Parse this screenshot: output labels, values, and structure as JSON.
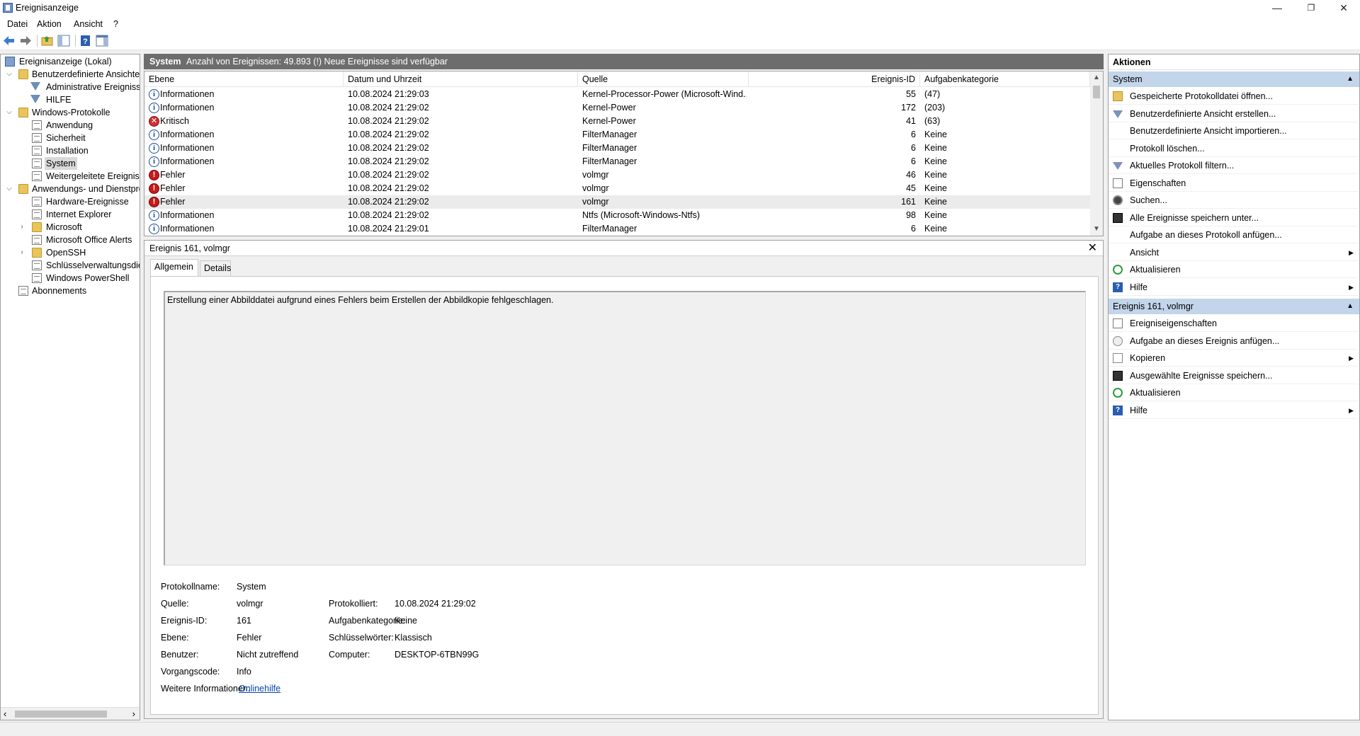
{
  "window": {
    "title": "Ereignisanzeige",
    "minimize": "—",
    "restore": "❐",
    "close": "✕"
  },
  "menu": [
    "Datei",
    "Aktion",
    "Ansicht",
    "?"
  ],
  "tree": {
    "root": "Ereignisanzeige (Lokal)",
    "custom_views": "Benutzerdefinierte Ansichten",
    "admin_events": "Administrative Ereignisse",
    "hilfe": "HILFE",
    "windows_logs": "Windows-Protokolle",
    "application": "Anwendung",
    "security": "Sicherheit",
    "installation": "Installation",
    "system": "System",
    "forwarded": "Weitergeleitete Ereignisse",
    "app_services": "Anwendungs- und Dienstprotokolle",
    "hardware": "Hardware-Ereignisse",
    "ie": "Internet Explorer",
    "microsoft": "Microsoft",
    "office_alerts": "Microsoft Office Alerts",
    "openssh": "OpenSSH",
    "key_mgmt": "Schlüsselverwaltungsdienst",
    "powershell": "Windows PowerShell",
    "subscriptions": "Abonnements"
  },
  "center_header": {
    "title": "System",
    "info": "Anzahl von Ereignissen: 49.893 (!) Neue Ereignisse sind verfügbar"
  },
  "grid": {
    "columns": [
      "Ebene",
      "Datum und Uhrzeit",
      "Quelle",
      "Ereignis-ID",
      "Aufgabenkategorie"
    ],
    "rows": [
      {
        "level": "Informationen",
        "kind": "info",
        "date": "10.08.2024 21:29:03",
        "source": "Kernel-Processor-Power (Microsoft-Wind...",
        "id": "55",
        "cat": "(47)"
      },
      {
        "level": "Informationen",
        "kind": "info",
        "date": "10.08.2024 21:29:02",
        "source": "Kernel-Power",
        "id": "172",
        "cat": "(203)"
      },
      {
        "level": "Kritisch",
        "kind": "crit",
        "date": "10.08.2024 21:29:02",
        "source": "Kernel-Power",
        "id": "41",
        "cat": "(63)"
      },
      {
        "level": "Informationen",
        "kind": "info",
        "date": "10.08.2024 21:29:02",
        "source": "FilterManager",
        "id": "6",
        "cat": "Keine"
      },
      {
        "level": "Informationen",
        "kind": "info",
        "date": "10.08.2024 21:29:02",
        "source": "FilterManager",
        "id": "6",
        "cat": "Keine"
      },
      {
        "level": "Informationen",
        "kind": "info",
        "date": "10.08.2024 21:29:02",
        "source": "FilterManager",
        "id": "6",
        "cat": "Keine"
      },
      {
        "level": "Fehler",
        "kind": "err",
        "date": "10.08.2024 21:29:02",
        "source": "volmgr",
        "id": "46",
        "cat": "Keine"
      },
      {
        "level": "Fehler",
        "kind": "err",
        "date": "10.08.2024 21:29:02",
        "source": "volmgr",
        "id": "45",
        "cat": "Keine"
      },
      {
        "level": "Fehler",
        "kind": "err",
        "date": "10.08.2024 21:29:02",
        "source": "volmgr",
        "id": "161",
        "cat": "Keine",
        "selected": true
      },
      {
        "level": "Informationen",
        "kind": "info",
        "date": "10.08.2024 21:29:02",
        "source": "Ntfs (Microsoft-Windows-Ntfs)",
        "id": "98",
        "cat": "Keine"
      },
      {
        "level": "Informationen",
        "kind": "info",
        "date": "10.08.2024 21:29:01",
        "source": "FilterManager",
        "id": "6",
        "cat": "Keine"
      }
    ]
  },
  "detail": {
    "header": "Ereignis 161, volmgr",
    "close": "✕",
    "tab_general": "Allgemein",
    "tab_details": "Details",
    "description": "Erstellung einer Abbilddatei aufgrund eines Fehlers beim Erstellen der Abbildkopie fehlgeschlagen.",
    "labels": {
      "log_name": "Protokollname:",
      "source": "Quelle:",
      "event_id": "Ereignis-ID:",
      "level": "Ebene:",
      "user": "Benutzer:",
      "opcode": "Vorgangscode:",
      "more_info": "Weitere Informationen:",
      "logged": "Protokolliert:",
      "task_category": "Aufgabenkategorie:",
      "keywords": "Schlüsselwörter:",
      "computer": "Computer:"
    },
    "values": {
      "log_name": "System",
      "source": "volmgr",
      "event_id": "161",
      "level": "Fehler",
      "user": "Nicht zutreffend",
      "opcode": "Info",
      "more_info": "Onlinehilfe",
      "logged": "10.08.2024 21:29:02",
      "task_category": "Keine",
      "keywords": "Klassisch",
      "computer": "DESKTOP-6TBN99G"
    }
  },
  "actions": {
    "title": "Aktionen",
    "section_system": "System",
    "system_items": [
      {
        "label": "Gespeicherte Protokolldatei öffnen...",
        "icon": "open-folder-icon"
      },
      {
        "label": "Benutzerdefinierte Ansicht erstellen...",
        "icon": "filter-icon"
      },
      {
        "label": "Benutzerdefinierte Ansicht importieren...",
        "icon": ""
      },
      {
        "label": "Protokoll löschen...",
        "icon": ""
      },
      {
        "label": "Aktuelles Protokoll filtern...",
        "icon": "filter-icon"
      },
      {
        "label": "Eigenschaften",
        "icon": "properties-icon"
      },
      {
        "label": "Suchen...",
        "icon": "find-icon"
      },
      {
        "label": "Alle Ereignisse speichern unter...",
        "icon": "save-icon"
      },
      {
        "label": "Aufgabe an dieses Protokoll anfügen...",
        "icon": ""
      },
      {
        "label": "Ansicht",
        "icon": "",
        "submenu": true
      },
      {
        "label": "Aktualisieren",
        "icon": "refresh-icon"
      },
      {
        "label": "Hilfe",
        "icon": "help-icon",
        "submenu": true
      }
    ],
    "section_event": "Ereignis 161, volmgr",
    "event_items": [
      {
        "label": "Ereigniseigenschaften",
        "icon": "properties-icon"
      },
      {
        "label": "Aufgabe an dieses Ereignis anfügen...",
        "icon": "task-icon"
      },
      {
        "label": "Kopieren",
        "icon": "copy-icon",
        "submenu": true
      },
      {
        "label": "Ausgewählte Ereignisse speichern...",
        "icon": "save-icon"
      },
      {
        "label": "Aktualisieren",
        "icon": "refresh-icon"
      },
      {
        "label": "Hilfe",
        "icon": "help-icon",
        "submenu": true
      }
    ]
  },
  "glyphs": {
    "expanded": "⌵",
    "collapsed": "›",
    "submenu": "▶",
    "collapse_section": "▲",
    "scroll_up": "▲",
    "scroll_down": "▼",
    "scroll_left": "‹",
    "scroll_right": "›",
    "info": "i",
    "crit": "✕",
    "err": "!",
    "help": "?"
  }
}
